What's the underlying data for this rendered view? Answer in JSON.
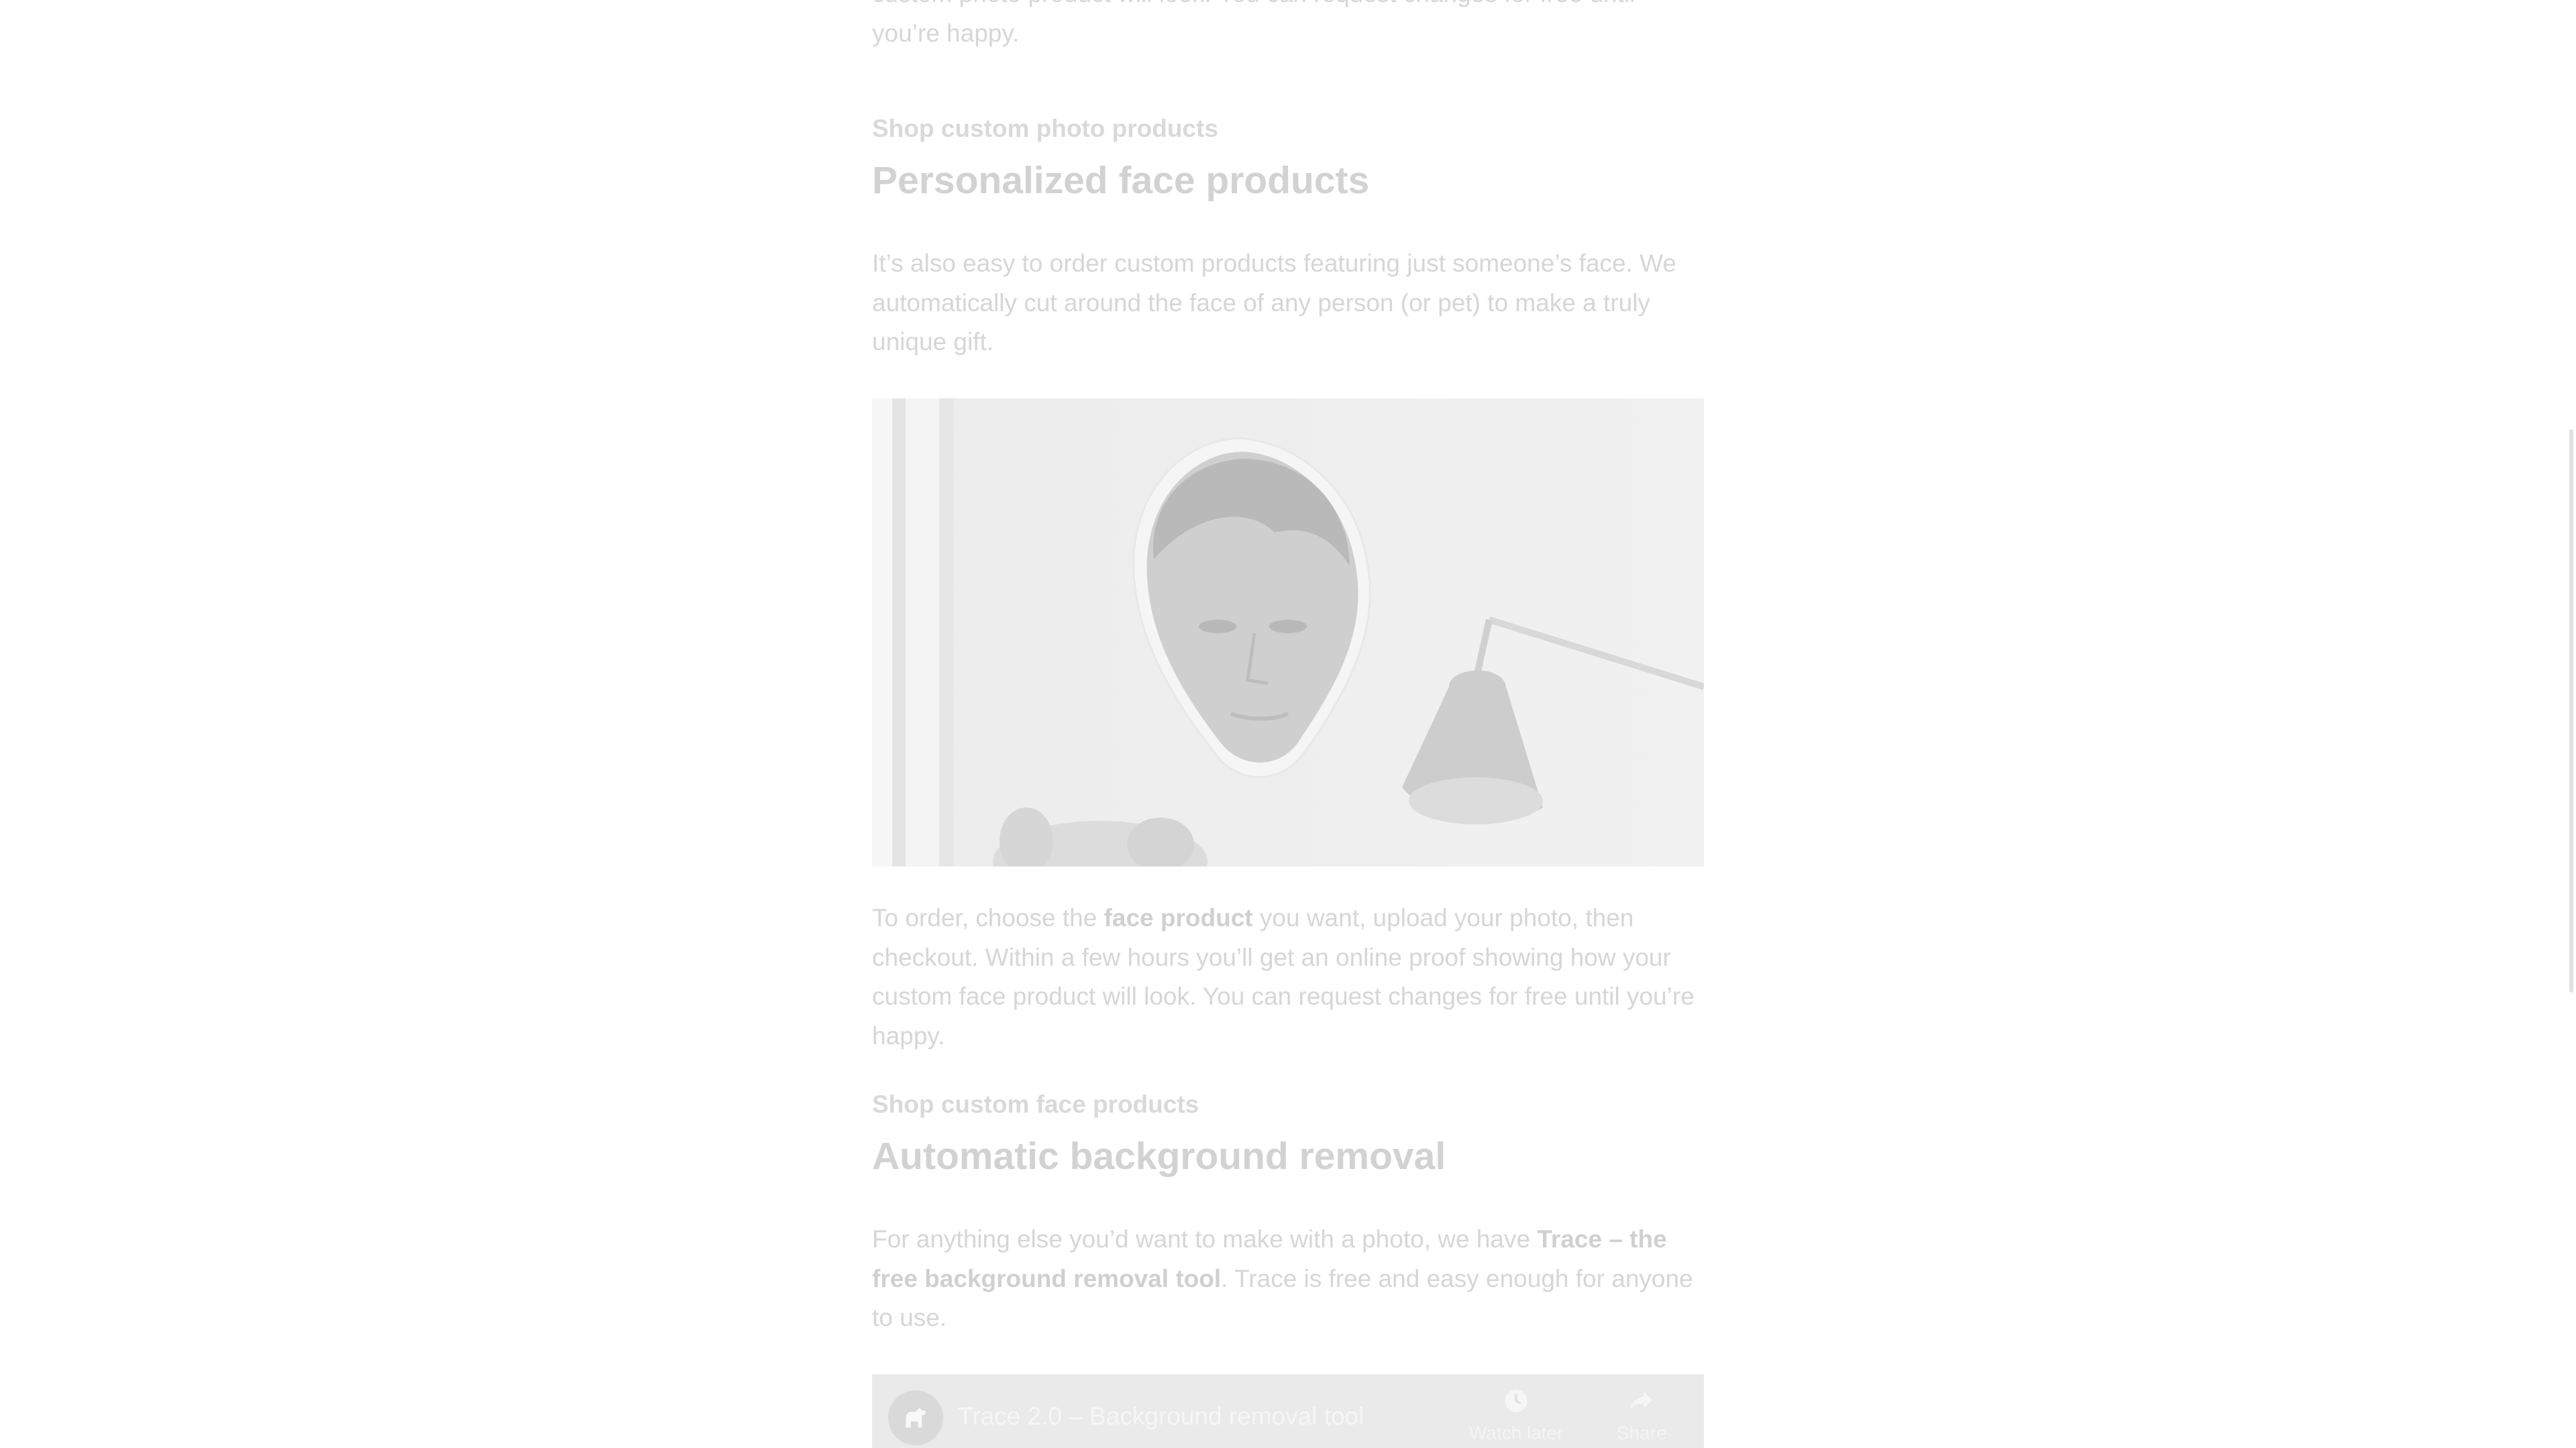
{
  "photo_section": {
    "tail_text": "custom photo product will look. You can request changes for free until you’re happy.",
    "shop_link": "Shop custom photo products"
  },
  "face_section": {
    "heading": "Personalized face products",
    "intro": "It’s also easy to order custom products featuring just someone’s face. We automatically cut around the face of any person (or pet) to make a truly unique gift.",
    "order_text_1": "To order, choose the ",
    "order_link": "face product",
    "order_text_2": " you want, upload your photo, then checkout. Within a few hours you’ll get an online proof showing how your custom face product will look. You can request changes for free until you’re happy.",
    "shop_link": "Shop custom face products"
  },
  "background_section": {
    "heading": "Automatic background removal",
    "text_1": "For anything else you’d want to make with a photo, we have ",
    "trace_link": "Trace – the free background removal tool",
    "text_2": ". Trace is free and easy enough for anyone to use."
  },
  "video": {
    "title": "Trace 2.0 – Background removal tool",
    "watch_later": "Watch later",
    "share": "Share",
    "channel_icon": "dog-icon",
    "watch_later_icon": "clock-icon",
    "share_icon": "share-arrow-icon"
  }
}
